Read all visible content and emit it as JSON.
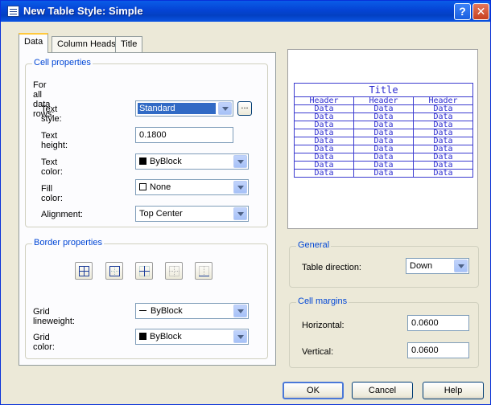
{
  "window": {
    "title": "New Table Style: Simple",
    "help_glyph": "?",
    "close_glyph": "✕"
  },
  "tabs": [
    {
      "label": "Data"
    },
    {
      "label": "Column Heads"
    },
    {
      "label": "Title"
    }
  ],
  "cell_properties": {
    "title": "Cell properties",
    "subtitle": "For all data rows:",
    "text_style": {
      "label": "Text style:",
      "value": "Standard",
      "browse_label": "..."
    },
    "text_height": {
      "label": "Text height:",
      "value": "0.1800"
    },
    "text_color": {
      "label": "Text color:",
      "value": "ByBlock"
    },
    "fill_color": {
      "label": "Fill color:",
      "value": "None"
    },
    "alignment": {
      "label": "Alignment:",
      "value": "Top Center"
    }
  },
  "border_properties": {
    "title": "Border properties",
    "buttons": [
      "all-borders-icon",
      "outside-borders-icon",
      "inside-borders-icon",
      "no-borders-icon",
      "bottom-border-icon"
    ],
    "grid_lineweight": {
      "label": "Grid lineweight:",
      "value": "ByBlock"
    },
    "grid_color": {
      "label": "Grid color:",
      "value": "ByBlock"
    }
  },
  "preview": {
    "title": "Title",
    "headers": [
      "Header",
      "Header",
      "Header"
    ],
    "rows": [
      [
        "Data",
        "Data",
        "Data"
      ],
      [
        "Data",
        "Data",
        "Data"
      ],
      [
        "Data",
        "Data",
        "Data"
      ],
      [
        "Data",
        "Data",
        "Data"
      ],
      [
        "Data",
        "Data",
        "Data"
      ],
      [
        "Data",
        "Data",
        "Data"
      ],
      [
        "Data",
        "Data",
        "Data"
      ],
      [
        "Data",
        "Data",
        "Data"
      ],
      [
        "Data",
        "Data",
        "Data"
      ]
    ],
    "text_color": "#2b2bd0"
  },
  "general": {
    "title": "General",
    "table_direction": {
      "label": "Table direction:",
      "value": "Down"
    }
  },
  "cell_margins": {
    "title": "Cell margins",
    "horizontal": {
      "label": "Horizontal:",
      "value": "0.0600"
    },
    "vertical": {
      "label": "Vertical:",
      "value": "0.0600"
    }
  },
  "buttons": {
    "ok": "OK",
    "cancel": "Cancel",
    "help": "Help"
  },
  "colors": {
    "title_bar": "#0a5ce8",
    "dialog_bg": "#ece9d8",
    "group_title": "#0046d5"
  }
}
